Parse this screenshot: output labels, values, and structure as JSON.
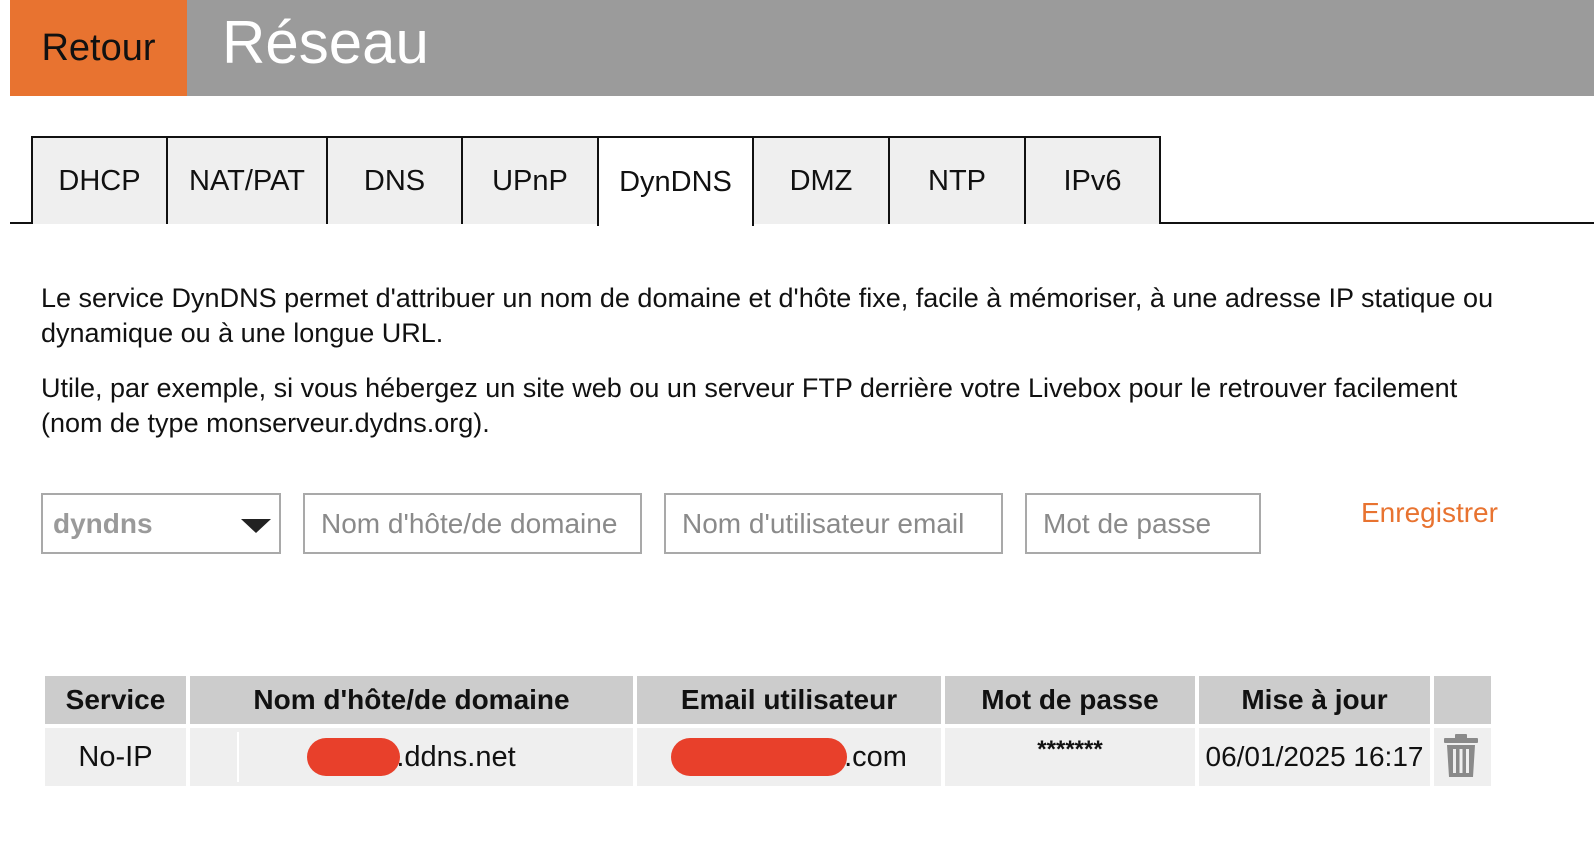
{
  "header": {
    "back_label": "Retour",
    "title": "Réseau"
  },
  "tabs": [
    {
      "label": "DHCP",
      "active": false
    },
    {
      "label": "NAT/PAT",
      "active": false
    },
    {
      "label": "DNS",
      "active": false
    },
    {
      "label": "UPnP",
      "active": false
    },
    {
      "label": "DynDNS",
      "active": true
    },
    {
      "label": "DMZ",
      "active": false
    },
    {
      "label": "NTP",
      "active": false
    },
    {
      "label": "IPv6",
      "active": false
    }
  ],
  "description": {
    "para1": "Le service DynDNS permet d'attribuer un nom de domaine et d'hôte fixe, facile à mémoriser, à une adresse IP statique ou dynamique ou à une longue URL.",
    "para2": "Utile, par exemple, si vous hébergez un site web ou un serveur FTP derrière votre Livebox pour le retrouver facilement (nom de type monserveur.dydns.org)."
  },
  "form": {
    "service_selected": "dyndns",
    "hostname_placeholder": "Nom d'hôte/de domaine",
    "username_placeholder": "Nom d'utilisateur email",
    "password_placeholder": "Mot de passe",
    "save_label": "Enregistrer"
  },
  "table": {
    "headers": [
      "Service",
      "Nom d'hôte/de domaine",
      "Email utilisateur",
      "Mot de passe",
      "Mise à jour"
    ],
    "rows": [
      {
        "service": "No-IP",
        "hostname_suffix": ".ddns.net",
        "email_suffix": ".com",
        "password": "*******",
        "updated": "06/01/2025 16:17"
      }
    ]
  },
  "colors": {
    "accent_orange": "#e87330",
    "header_gray": "#9b9b9b",
    "redaction_red": "#e8402b"
  },
  "icons": [
    "trash-icon",
    "chevron-down-icon"
  ]
}
